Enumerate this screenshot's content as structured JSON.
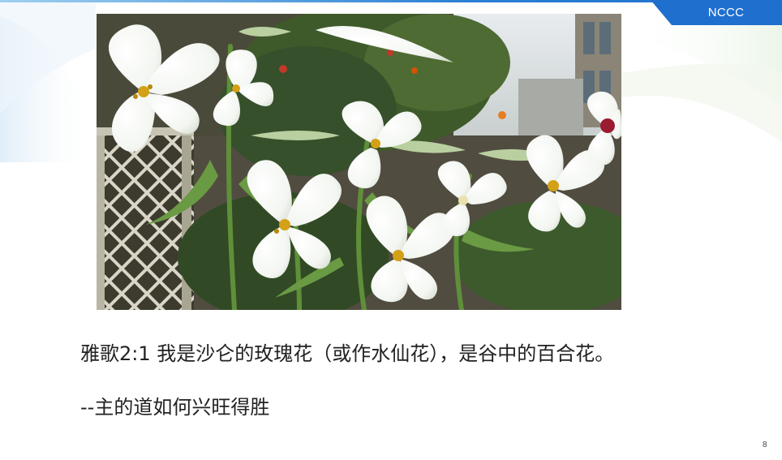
{
  "slide": {
    "brand": "NCCC",
    "verse": "雅歌2:1 我是沙仑的玫瑰花（或作水仙花），是谷中的百合花。",
    "source": "--主的道如何兴旺得胜",
    "page_number": "8"
  },
  "image": {
    "subject": "white lilies in a garden with lattice fence",
    "icon": "lily-photo"
  },
  "colors": {
    "accent": "#1f6fcf",
    "text": "#222222"
  }
}
